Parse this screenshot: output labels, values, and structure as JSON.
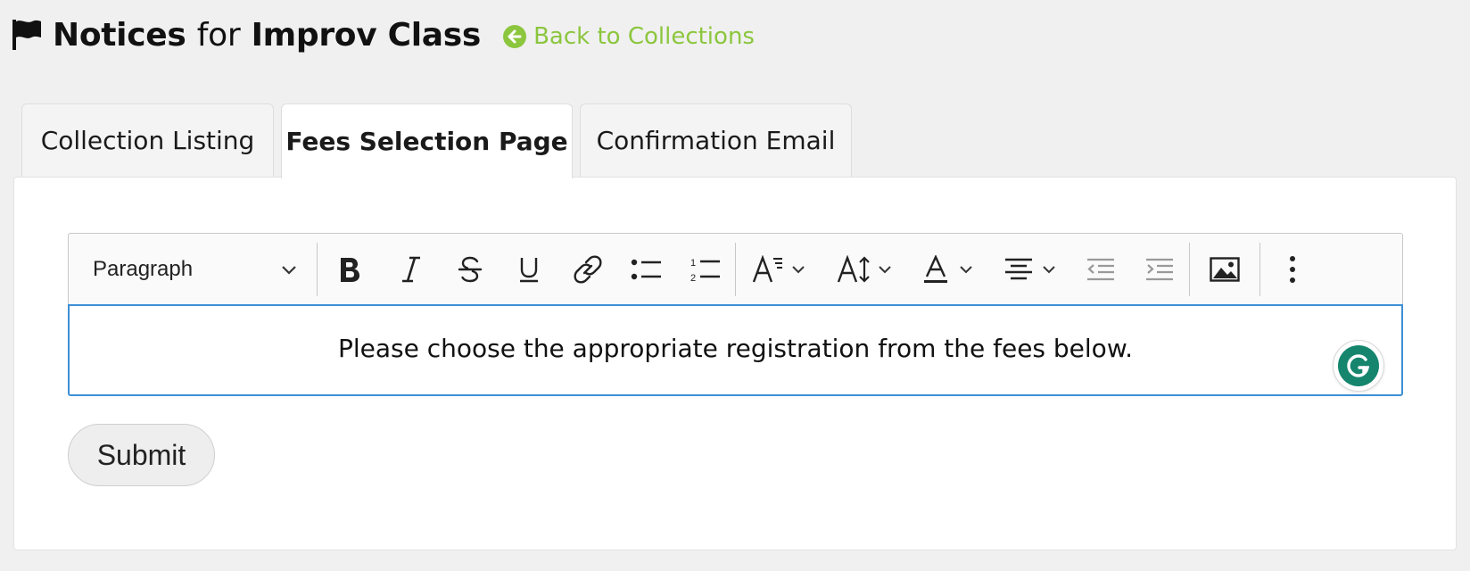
{
  "header": {
    "title_bold_1": "Notices",
    "title_for": "for",
    "title_bold_2": "Improv Class",
    "back_link": "Back to Collections",
    "icon": "flag-icon",
    "back_icon": "arrow-left-circle-icon"
  },
  "tabs": [
    {
      "label": "Collection Listing",
      "active": false
    },
    {
      "label": "Fees Selection Page",
      "active": true
    },
    {
      "label": "Confirmation Email",
      "active": false
    }
  ],
  "editor": {
    "block_format": "Paragraph",
    "toolbar_icons": [
      "bold-icon",
      "italic-icon",
      "strikethrough-icon",
      "underline-icon",
      "link-icon",
      "bulleted-list-icon",
      "numbered-list-icon",
      "font-family-icon",
      "font-size-icon",
      "font-color-icon",
      "align-center-icon",
      "outdent-icon",
      "indent-icon",
      "insert-image-icon",
      "more-options-icon"
    ],
    "content": "Please choose the appropriate registration from the fees below.",
    "assistant_icon": "grammarly-icon"
  },
  "form": {
    "submit_label": "Submit"
  },
  "colors": {
    "accent": "#8cc63e",
    "focus_border": "#3d8fd6",
    "grammarly": "#15856e",
    "background": "#f0f0f0"
  }
}
